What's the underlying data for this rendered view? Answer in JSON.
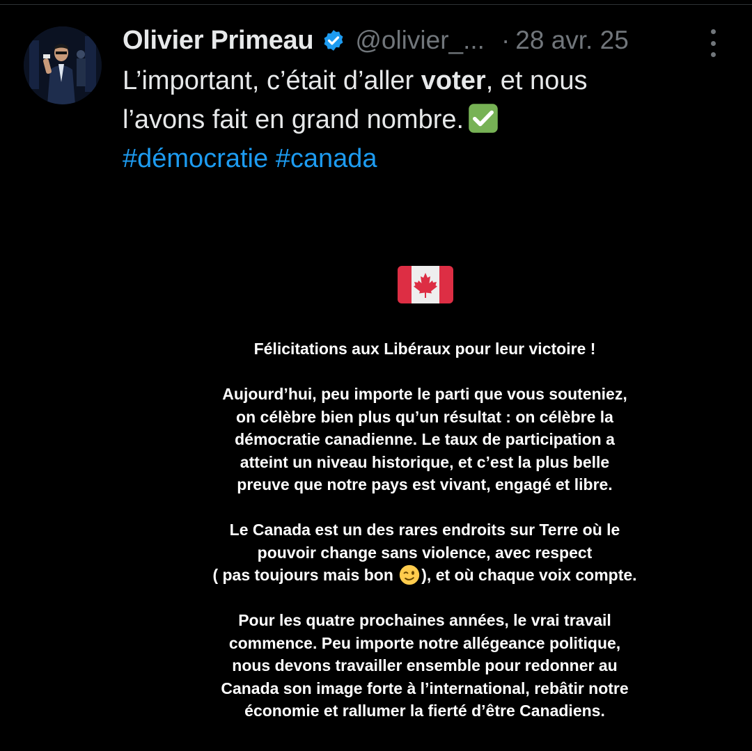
{
  "tweet": {
    "author": {
      "name": "Olivier Primeau",
      "handle": "@olivier_...",
      "verified_icon": "verified-badge-icon"
    },
    "separator": "·",
    "date": "28 avr. 25",
    "text": {
      "line1_pre": "L’important, c’était d’aller ",
      "line1_bold": "voter",
      "line1_post": ", et nous",
      "line2": "l’avons fait en grand nombre.",
      "line2_emoji": "check-mark-button-icon",
      "hashtags": [
        "#démocratie",
        "#canada"
      ]
    },
    "colors": {
      "background": "#000000",
      "text": "#e7e9ea",
      "secondary": "#71767b",
      "link": "#1d9bf0",
      "verified": "#1d9bf0"
    }
  },
  "image": {
    "flag_emoji": "canada-flag-icon",
    "paragraphs": [
      [
        "Félicitations aux Libéraux pour leur victoire !"
      ],
      [
        "Aujourd’hui, peu importe le parti que vous souteniez,",
        "on célèbre bien plus qu’un résultat : on célèbre la",
        "démocratie canadienne. Le taux de participation a",
        "atteint un niveau historique, et c’est la plus belle",
        "preuve que notre pays est vivant, engagé et libre."
      ],
      [
        "Le Canada est un des rares endroits sur Terre où le",
        "pouvoir change sans violence, avec respect"
      ],
      [
        "Pour les quatre prochaines années, le vrai travail",
        "commence. Peu importe notre allégeance politique,",
        "nous devons travailler ensemble pour redonner au",
        "Canada son image forte à l’international, rebâtir notre",
        "économie et rallumer la fierté d’être Canadiens."
      ]
    ],
    "wink_line_pre": "( pas toujours mais bon",
    "wink_line_emoji": "winking-face-icon",
    "wink_line_post": "), et où chaque voix compte."
  }
}
